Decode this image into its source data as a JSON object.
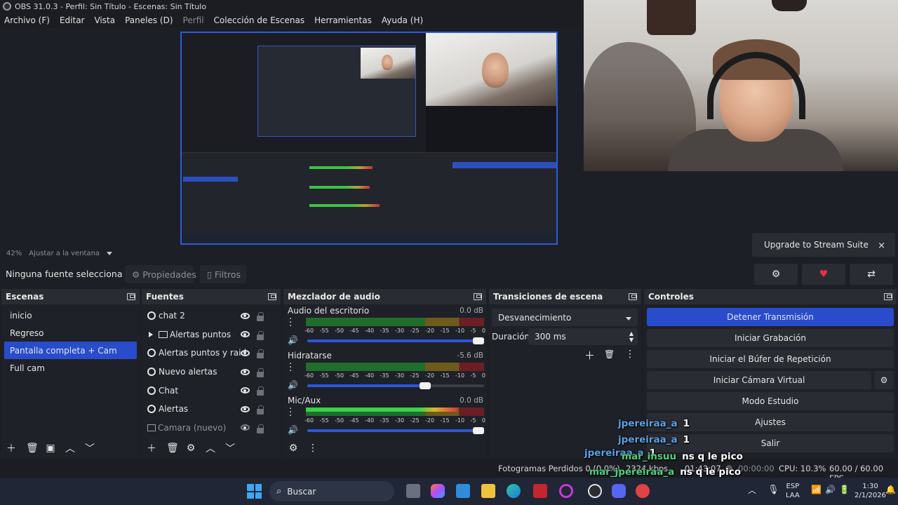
{
  "window": {
    "title": "OBS 31.0.3 - Perfil: Sin Título - Escenas: Sin Título"
  },
  "menu": {
    "items": [
      "Archivo (F)",
      "Editar",
      "Vista",
      "Paneles (D)",
      "Perfil",
      "Colección de Escenas",
      "Herramientas",
      "Ayuda (H)"
    ]
  },
  "preview": {
    "zoom": "42%",
    "fit_label": "Ajustar a la ventana"
  },
  "suite": {
    "upgrade_label": "Upgrade to Stream Suite",
    "close_symbol": "×",
    "buttons": [
      "gear-icon",
      "heart-icon",
      "share-icon"
    ]
  },
  "source_bar": {
    "no_source": "Ninguna fuente selecciona",
    "properties": "Propiedades",
    "filters": "Filtros"
  },
  "scenes": {
    "title": "Escenas",
    "items": [
      "inicio",
      "Regreso",
      "Pantalla completa + Cam",
      "Full cam"
    ],
    "active_index": 2
  },
  "sources": {
    "title": "Fuentes",
    "items": [
      "chat 2",
      "Alertas puntos",
      "Alertas puntos y raid",
      "Nuevo alertas",
      "Chat",
      "Alertas",
      "Camara (nuevo)"
    ]
  },
  "mixer": {
    "title": "Mezclador de audio",
    "ticks": [
      "-60",
      "-55",
      "-50",
      "-45",
      "-40",
      "-35",
      "-30",
      "-25",
      "-20",
      "-15",
      "-10",
      "-5",
      "0"
    ],
    "channels": [
      {
        "name": "Audio del escritorio",
        "db": "0.0 dB",
        "level": 0,
        "volume": 1.0
      },
      {
        "name": "Hidratarse",
        "db": "-5.6 dB",
        "level": 0,
        "volume": 0.7
      },
      {
        "name": "Mic/Aux",
        "db": "0.0 dB",
        "level": 0.85,
        "volume": 1.0
      }
    ]
  },
  "transitions": {
    "title": "Transiciones de escena",
    "selected": "Desvanecimiento",
    "duration_label": "Duración",
    "duration_value": "300 ms"
  },
  "controls": {
    "title": "Controles",
    "stop_stream": "Detener Transmisión",
    "start_recording": "Iniciar Grabación",
    "replay_buffer": "Iniciar el Búfer de Repetición",
    "virtual_cam": "Iniciar Cámara Virtual",
    "studio_mode": "Modo Estudio",
    "settings": "Ajustes",
    "exit": "Salir"
  },
  "status": {
    "dropped": "Fotogramas Perdidos 0 (0.0%)",
    "bitrate": "2324 kbps",
    "stream_time": "01:43:07",
    "rec_time": "00:00:00",
    "cpu": "CPU: 10.3%",
    "fps": "60.00 / 60.00 FPS"
  },
  "chat": [
    {
      "user": "jpereiraa_a",
      "msg": "1"
    },
    {
      "user": "jpereiraa_a",
      "msg": "1"
    },
    {
      "user": "jpereiraa_a",
      "msg": "1"
    },
    {
      "user": "mar_insuu",
      "msg": "ns q le pico"
    },
    {
      "user": "mar_jpereiraa_a",
      "msg": "ns q le pico"
    },
    {
      "user": "jpereiraa_a",
      "msg": "1"
    }
  ],
  "taskbar": {
    "search": "Buscar",
    "lang1": "ESP",
    "lang2": "LAA",
    "time": "1:30",
    "date": "2/1/2026"
  }
}
